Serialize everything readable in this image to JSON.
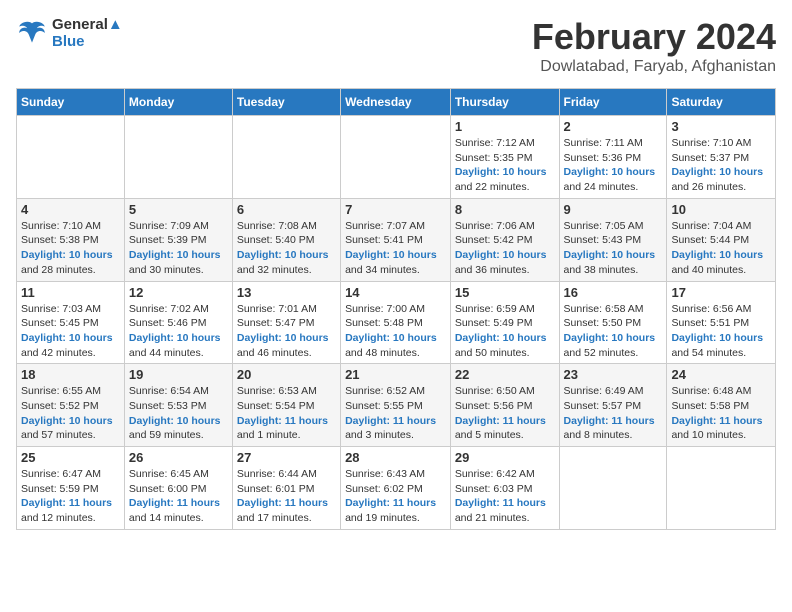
{
  "logo": {
    "line1": "General",
    "line2": "Blue"
  },
  "title": "February 2024",
  "location": "Dowlatabad, Faryab, Afghanistan",
  "days_of_week": [
    "Sunday",
    "Monday",
    "Tuesday",
    "Wednesday",
    "Thursday",
    "Friday",
    "Saturday"
  ],
  "weeks": [
    [
      {
        "day": "",
        "info": []
      },
      {
        "day": "",
        "info": []
      },
      {
        "day": "",
        "info": []
      },
      {
        "day": "",
        "info": []
      },
      {
        "day": "1",
        "info": [
          "Sunrise: 7:12 AM",
          "Sunset: 5:35 PM",
          "Daylight: 10 hours",
          "and 22 minutes."
        ]
      },
      {
        "day": "2",
        "info": [
          "Sunrise: 7:11 AM",
          "Sunset: 5:36 PM",
          "Daylight: 10 hours",
          "and 24 minutes."
        ]
      },
      {
        "day": "3",
        "info": [
          "Sunrise: 7:10 AM",
          "Sunset: 5:37 PM",
          "Daylight: 10 hours",
          "and 26 minutes."
        ]
      }
    ],
    [
      {
        "day": "4",
        "info": [
          "Sunrise: 7:10 AM",
          "Sunset: 5:38 PM",
          "Daylight: 10 hours",
          "and 28 minutes."
        ]
      },
      {
        "day": "5",
        "info": [
          "Sunrise: 7:09 AM",
          "Sunset: 5:39 PM",
          "Daylight: 10 hours",
          "and 30 minutes."
        ]
      },
      {
        "day": "6",
        "info": [
          "Sunrise: 7:08 AM",
          "Sunset: 5:40 PM",
          "Daylight: 10 hours",
          "and 32 minutes."
        ]
      },
      {
        "day": "7",
        "info": [
          "Sunrise: 7:07 AM",
          "Sunset: 5:41 PM",
          "Daylight: 10 hours",
          "and 34 minutes."
        ]
      },
      {
        "day": "8",
        "info": [
          "Sunrise: 7:06 AM",
          "Sunset: 5:42 PM",
          "Daylight: 10 hours",
          "and 36 minutes."
        ]
      },
      {
        "day": "9",
        "info": [
          "Sunrise: 7:05 AM",
          "Sunset: 5:43 PM",
          "Daylight: 10 hours",
          "and 38 minutes."
        ]
      },
      {
        "day": "10",
        "info": [
          "Sunrise: 7:04 AM",
          "Sunset: 5:44 PM",
          "Daylight: 10 hours",
          "and 40 minutes."
        ]
      }
    ],
    [
      {
        "day": "11",
        "info": [
          "Sunrise: 7:03 AM",
          "Sunset: 5:45 PM",
          "Daylight: 10 hours",
          "and 42 minutes."
        ]
      },
      {
        "day": "12",
        "info": [
          "Sunrise: 7:02 AM",
          "Sunset: 5:46 PM",
          "Daylight: 10 hours",
          "and 44 minutes."
        ]
      },
      {
        "day": "13",
        "info": [
          "Sunrise: 7:01 AM",
          "Sunset: 5:47 PM",
          "Daylight: 10 hours",
          "and 46 minutes."
        ]
      },
      {
        "day": "14",
        "info": [
          "Sunrise: 7:00 AM",
          "Sunset: 5:48 PM",
          "Daylight: 10 hours",
          "and 48 minutes."
        ]
      },
      {
        "day": "15",
        "info": [
          "Sunrise: 6:59 AM",
          "Sunset: 5:49 PM",
          "Daylight: 10 hours",
          "and 50 minutes."
        ]
      },
      {
        "day": "16",
        "info": [
          "Sunrise: 6:58 AM",
          "Sunset: 5:50 PM",
          "Daylight: 10 hours",
          "and 52 minutes."
        ]
      },
      {
        "day": "17",
        "info": [
          "Sunrise: 6:56 AM",
          "Sunset: 5:51 PM",
          "Daylight: 10 hours",
          "and 54 minutes."
        ]
      }
    ],
    [
      {
        "day": "18",
        "info": [
          "Sunrise: 6:55 AM",
          "Sunset: 5:52 PM",
          "Daylight: 10 hours",
          "and 57 minutes."
        ]
      },
      {
        "day": "19",
        "info": [
          "Sunrise: 6:54 AM",
          "Sunset: 5:53 PM",
          "Daylight: 10 hours",
          "and 59 minutes."
        ]
      },
      {
        "day": "20",
        "info": [
          "Sunrise: 6:53 AM",
          "Sunset: 5:54 PM",
          "Daylight: 11 hours",
          "and 1 minute."
        ]
      },
      {
        "day": "21",
        "info": [
          "Sunrise: 6:52 AM",
          "Sunset: 5:55 PM",
          "Daylight: 11 hours",
          "and 3 minutes."
        ]
      },
      {
        "day": "22",
        "info": [
          "Sunrise: 6:50 AM",
          "Sunset: 5:56 PM",
          "Daylight: 11 hours",
          "and 5 minutes."
        ]
      },
      {
        "day": "23",
        "info": [
          "Sunrise: 6:49 AM",
          "Sunset: 5:57 PM",
          "Daylight: 11 hours",
          "and 8 minutes."
        ]
      },
      {
        "day": "24",
        "info": [
          "Sunrise: 6:48 AM",
          "Sunset: 5:58 PM",
          "Daylight: 11 hours",
          "and 10 minutes."
        ]
      }
    ],
    [
      {
        "day": "25",
        "info": [
          "Sunrise: 6:47 AM",
          "Sunset: 5:59 PM",
          "Daylight: 11 hours",
          "and 12 minutes."
        ]
      },
      {
        "day": "26",
        "info": [
          "Sunrise: 6:45 AM",
          "Sunset: 6:00 PM",
          "Daylight: 11 hours",
          "and 14 minutes."
        ]
      },
      {
        "day": "27",
        "info": [
          "Sunrise: 6:44 AM",
          "Sunset: 6:01 PM",
          "Daylight: 11 hours",
          "and 17 minutes."
        ]
      },
      {
        "day": "28",
        "info": [
          "Sunrise: 6:43 AM",
          "Sunset: 6:02 PM",
          "Daylight: 11 hours",
          "and 19 minutes."
        ]
      },
      {
        "day": "29",
        "info": [
          "Sunrise: 6:42 AM",
          "Sunset: 6:03 PM",
          "Daylight: 11 hours",
          "and 21 minutes."
        ]
      },
      {
        "day": "",
        "info": []
      },
      {
        "day": "",
        "info": []
      }
    ]
  ]
}
